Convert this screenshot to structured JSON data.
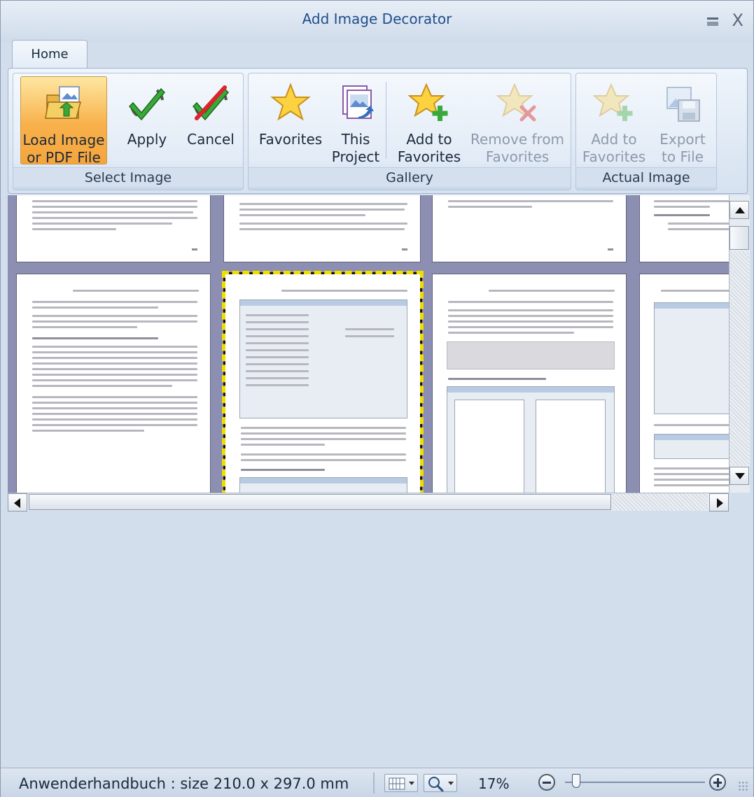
{
  "window": {
    "title": "Add Image Decorator",
    "minimize_icon": "minimize-icon",
    "close_icon": "close-icon",
    "close_glyph": "X"
  },
  "ribbon": {
    "tabs": [
      {
        "label": "Home",
        "active": true
      }
    ],
    "groups": {
      "select_image": {
        "label": "Select Image",
        "buttons": {
          "load": {
            "line1": "Load Image",
            "line2": "or PDF File",
            "icon": "folder-image-icon",
            "active": true
          },
          "apply": {
            "line1": "Apply",
            "line2": "",
            "icon": "apply-check-icon"
          },
          "cancel": {
            "line1": "Cancel",
            "line2": "",
            "icon": "cancel-icon"
          }
        }
      },
      "gallery": {
        "label": "Gallery",
        "buttons": {
          "favorites": {
            "line1": "Favorites",
            "line2": "",
            "icon": "star-icon"
          },
          "this_project": {
            "line1": "This",
            "line2": "Project",
            "icon": "project-images-icon"
          },
          "add_fav": {
            "line1": "Add to",
            "line2": "Favorites",
            "icon": "star-add-icon"
          },
          "remove_fav": {
            "line1": "Remove from",
            "line2": "Favorites",
            "icon": "star-remove-icon",
            "disabled": true
          }
        }
      },
      "actual_image": {
        "label": "Actual Image",
        "buttons": {
          "add_fav": {
            "line1": "Add to",
            "line2": "Favorites",
            "icon": "star-add-icon",
            "disabled": true
          },
          "export": {
            "line1": "Export",
            "line2": "to File",
            "icon": "export-file-icon",
            "disabled": true
          }
        }
      }
    }
  },
  "statusbar": {
    "document_info": "Anwenderhandbuch : size 210.0 x 297.0 mm",
    "zoom_percent": "17%",
    "zoom_level": 0.05,
    "layout_icon": "page-grid-icon",
    "zoom_icon": "magnifier-icon"
  },
  "colors": {
    "viewer_background": "#8c8fb2",
    "selection_outline": "#f0dc00",
    "active_button": "#f8b14b"
  }
}
